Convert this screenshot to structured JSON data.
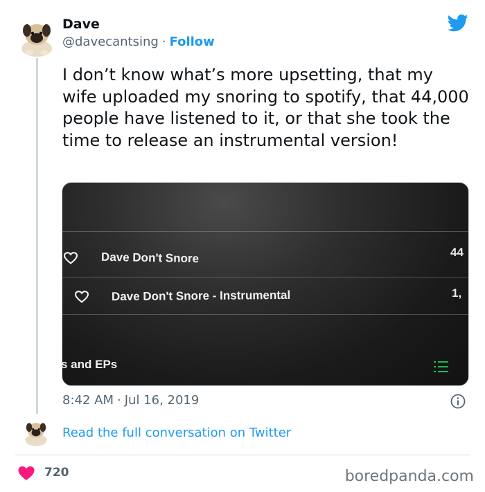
{
  "tweet": {
    "author_name": "Dave",
    "author_handle": "@davecantsing",
    "separator": "·",
    "follow_label": "Follow",
    "text": "I don’t know what’s more upsetting, that my wife uploaded my snoring to spotify, that 44,000 people have listened to it, or that she took the time to release an instrumental version!",
    "time": "8:42 AM",
    "date": "Jul 16, 2019",
    "read_more_label": "Read the full conversation on Twitter",
    "like_count": "720"
  },
  "media": {
    "tracks": [
      {
        "title": "Dave Don't Snore",
        "plays": "44"
      },
      {
        "title": "Dave Don't Snore - Instrumental",
        "plays": "1,"
      }
    ],
    "section_label": "s and EPs"
  },
  "icons": {
    "brand": "twitter-bird-icon",
    "info": "info-icon",
    "like": "heart-icon"
  },
  "colors": {
    "twitter_blue": "#1d9bf0",
    "like_red": "#f91880",
    "spotify_green": "#1db954",
    "secondary_text": "#536471"
  },
  "footer": {
    "watermark": "boredpanda.com"
  }
}
